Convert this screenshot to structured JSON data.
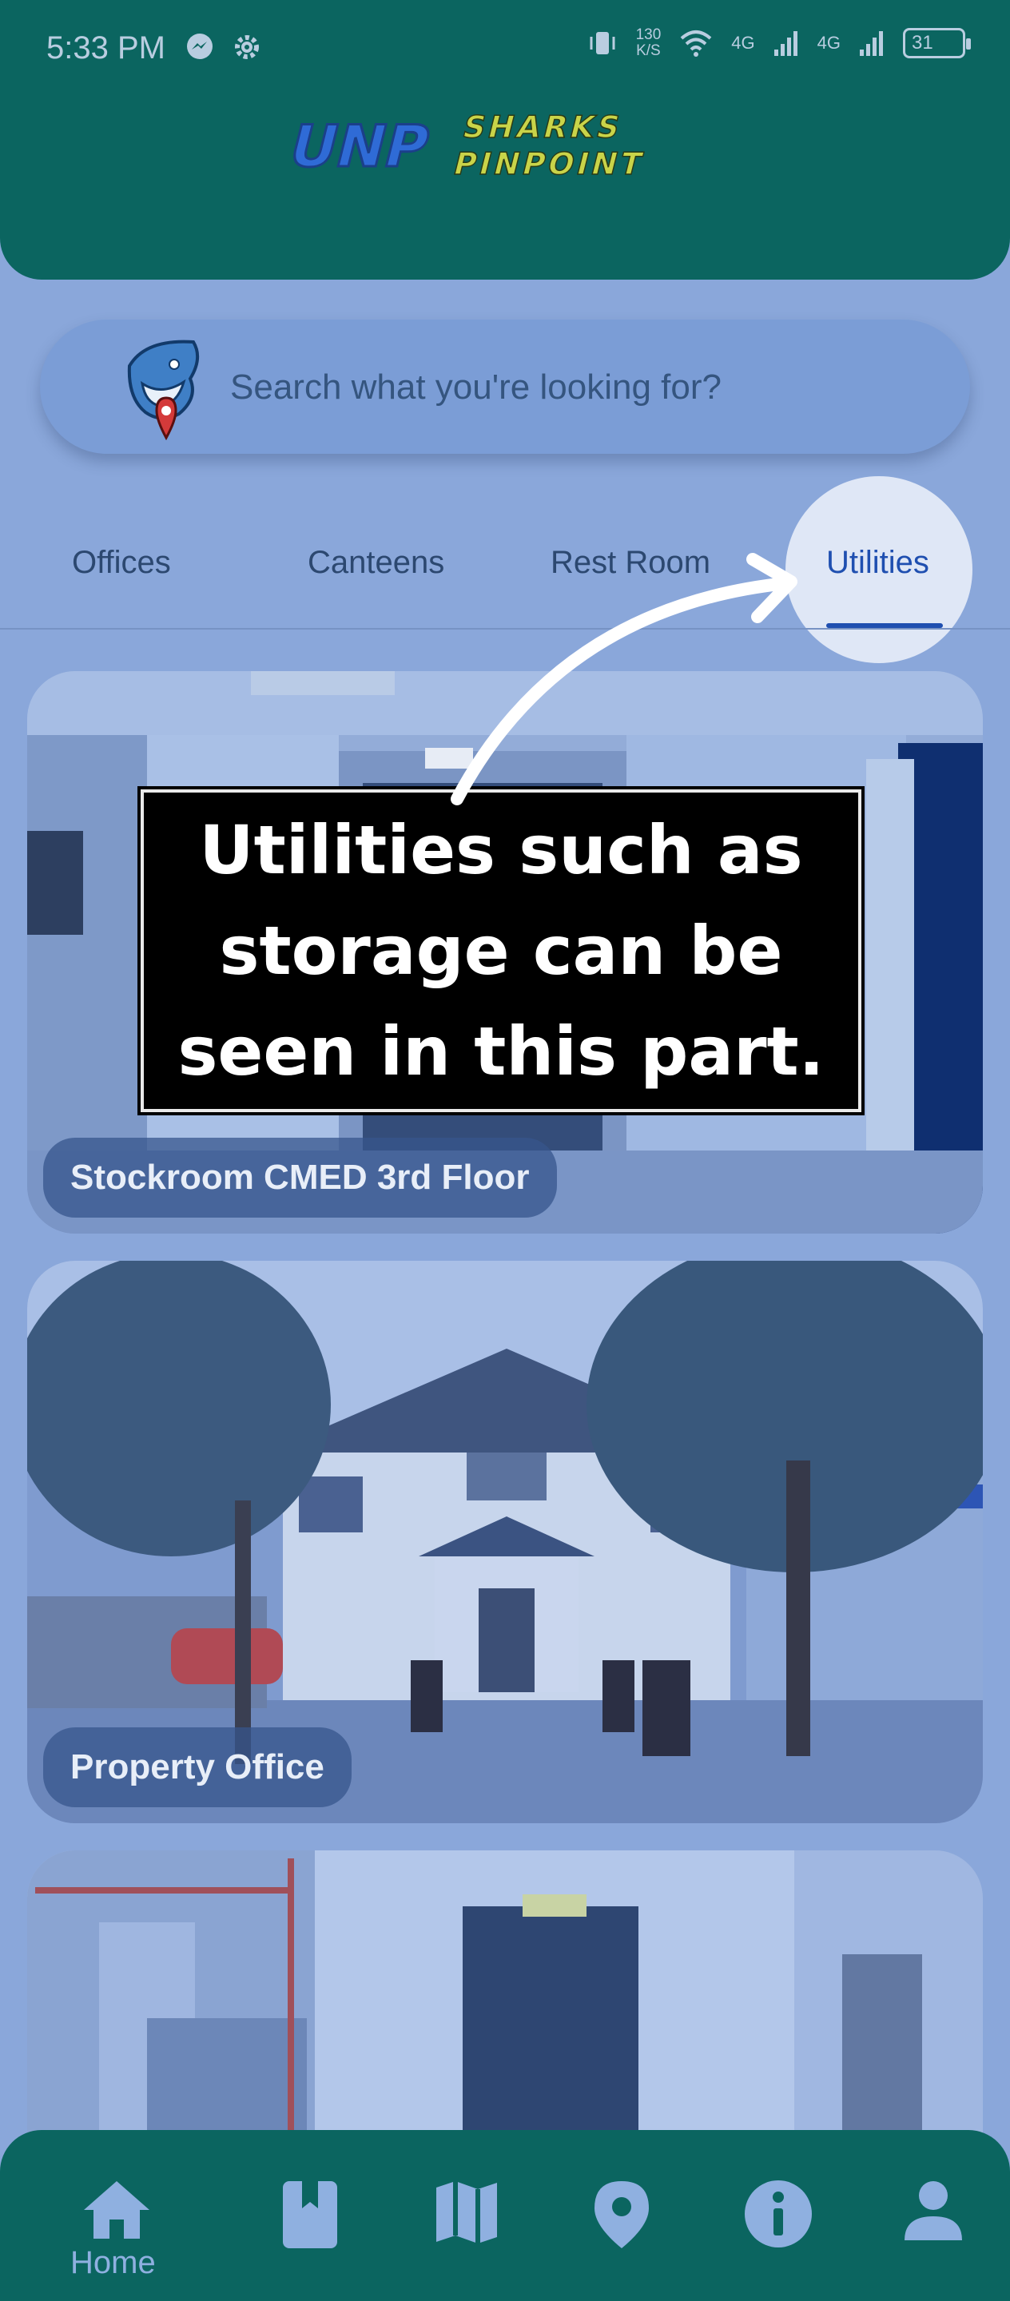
{
  "status_bar": {
    "time": "5:33 PM",
    "net_speed_value": "130",
    "net_speed_unit": "K/S",
    "signal_1": "4G",
    "signal_2": "4G",
    "battery": "31"
  },
  "search": {
    "placeholder": "Search what you're looking for?"
  },
  "tabs": [
    {
      "label": "Offices",
      "active": false
    },
    {
      "label": "Canteens",
      "active": false
    },
    {
      "label": "Rest Room",
      "active": false
    },
    {
      "label": "Utilities",
      "active": true
    }
  ],
  "cards": [
    {
      "label": "Stockroom CMED 3rd Floor"
    },
    {
      "label": "Property Office"
    },
    {
      "label": ""
    }
  ],
  "callout": {
    "line1": "Utilities such as",
    "line2": "storage can be",
    "line3": "seen in this part."
  },
  "bottom_nav": [
    {
      "icon": "home-icon",
      "label": "Home",
      "active": true
    },
    {
      "icon": "book-icon",
      "label": "",
      "active": false
    },
    {
      "icon": "map-icon",
      "label": "",
      "active": false
    },
    {
      "icon": "location-pin-icon",
      "label": "",
      "active": false
    },
    {
      "icon": "info-icon",
      "label": "",
      "active": false
    },
    {
      "icon": "profile-icon",
      "label": "",
      "active": false
    }
  ],
  "colors": {
    "header": "#0b6560",
    "background": "#8aa7da",
    "accent": "#1f4fb0"
  }
}
